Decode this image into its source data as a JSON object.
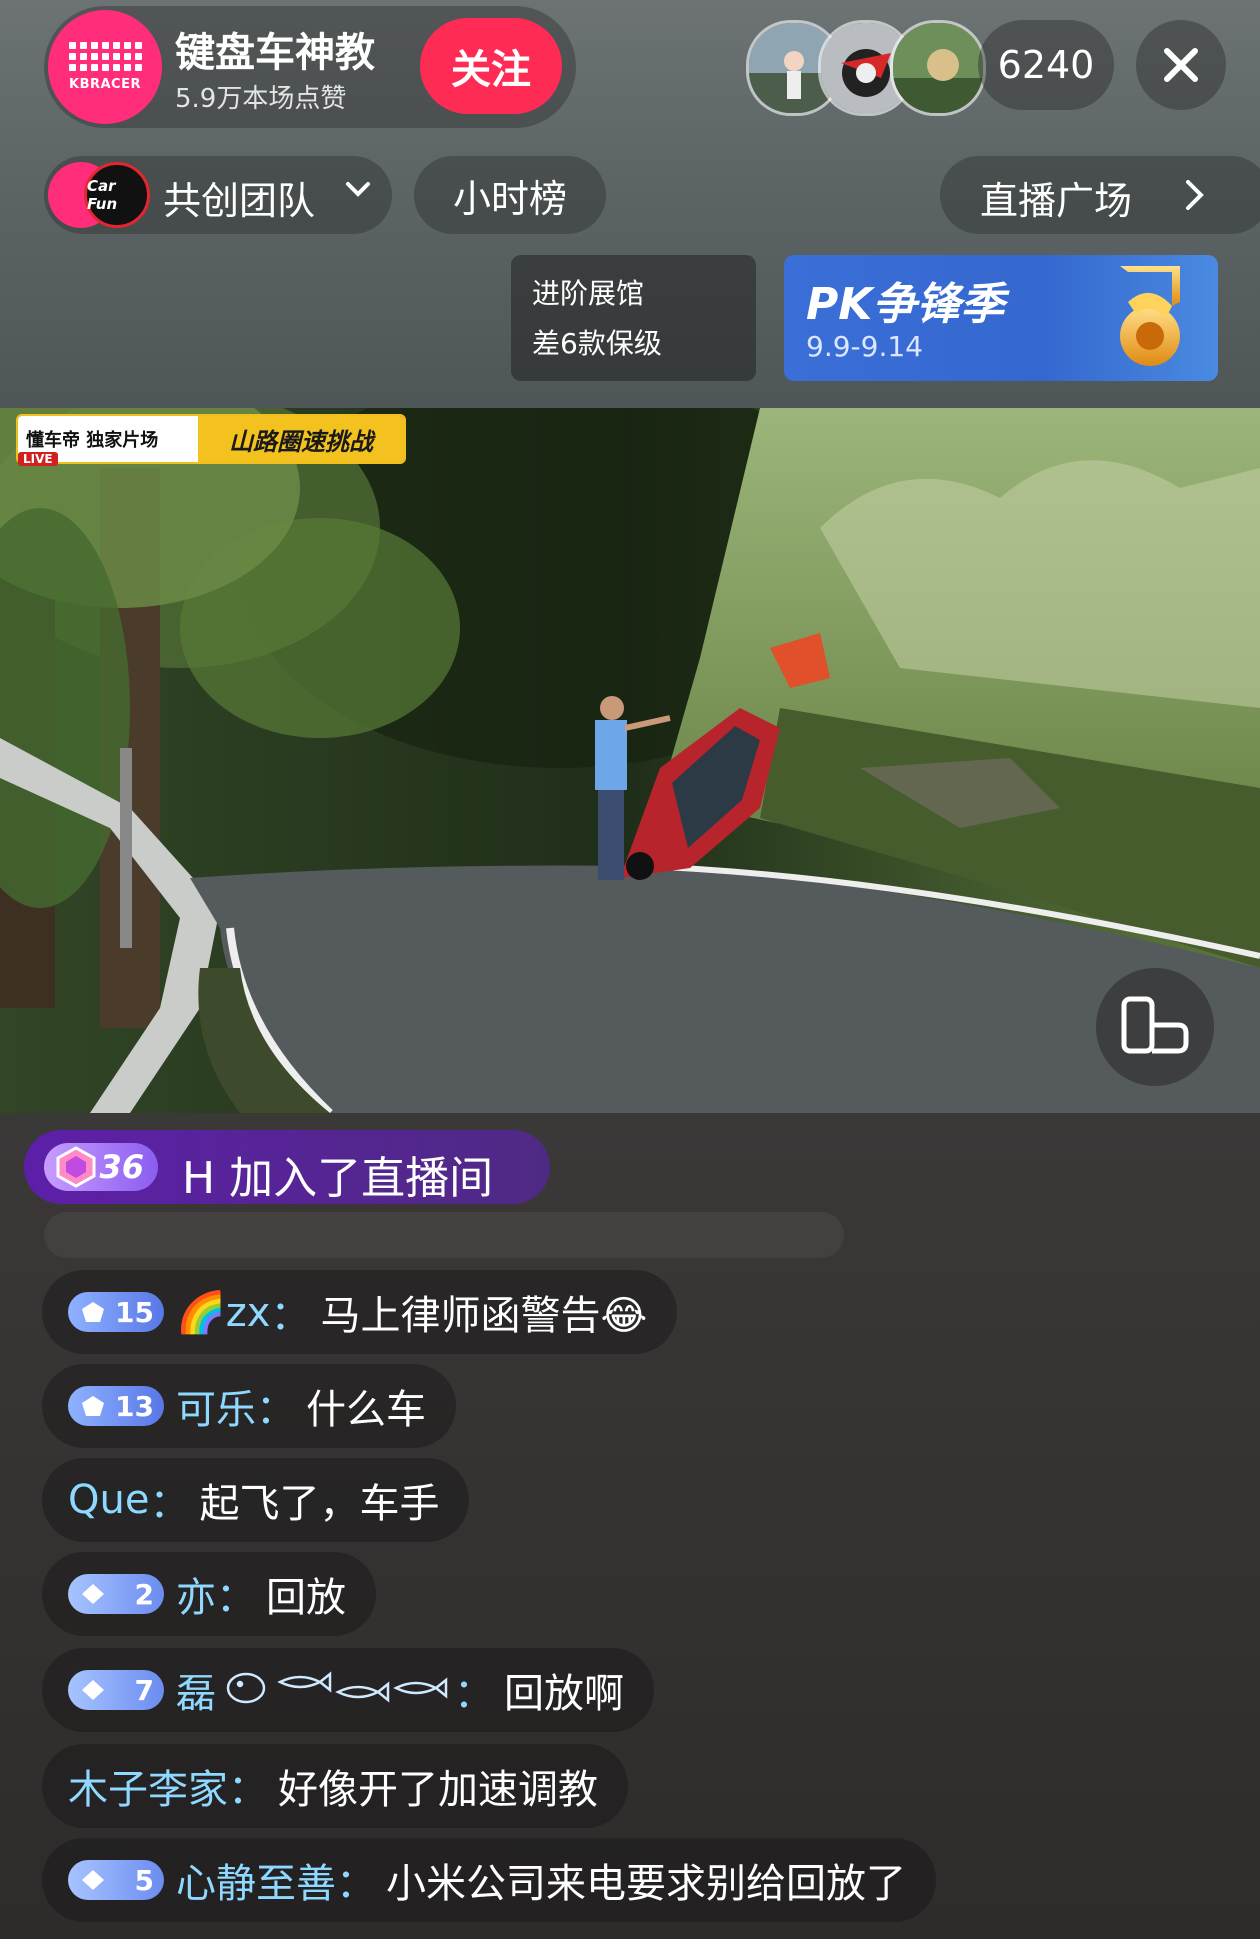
{
  "header": {
    "host_name": "键盘车神教",
    "host_likes": "5.9万本场点赞",
    "host_avatar_text": "KBRACER",
    "follow_label": "关注",
    "viewer_count": "6240"
  },
  "nav": {
    "team_label": "共创团队",
    "team_avatar_text": "Car Fun",
    "hour_rank_label": "小时榜",
    "live_square_label": "直播广场"
  },
  "promo": {
    "exhibit_line1": "进阶展馆",
    "exhibit_line2": "差6款保级",
    "pk_title": "PK争锋季",
    "pk_dates": "9.9-9.14"
  },
  "video": {
    "show_brand": "懂车帝 独家片场",
    "show_title": "山路圈速挑战",
    "live_label": "LIVE"
  },
  "chat": {
    "join": {
      "level": "36",
      "text": "H 加入了直播间"
    },
    "messages": [
      {
        "level": "15",
        "user": "🌈zx",
        "content": "马上律师函警告😂"
      },
      {
        "level": "13",
        "user": "可乐",
        "content": "什么车"
      },
      {
        "level": "",
        "user": "Que",
        "content": "起飞了，车手"
      },
      {
        "level": "2",
        "user": "亦",
        "content": "回放"
      },
      {
        "level": "7",
        "user": "磊",
        "content": "回放啊"
      },
      {
        "level": "",
        "user": "木子李家",
        "content": "好像开了加速调教"
      },
      {
        "level": "5",
        "user": "心静至善",
        "content": "小米公司来电要求别给回放了"
      }
    ]
  },
  "colors": {
    "follow": "#fe2c55",
    "brand_pink": "#ff2d7a",
    "username": "#8fd8ff",
    "pk_blue": "#3468cf",
    "join_purple": "#5d1fa8"
  },
  "icons": [
    "keyboard-logo-icon",
    "close-icon",
    "chevron-down-icon",
    "chevron-right-icon",
    "trophy-badge-icon",
    "rotate-screen-icon",
    "gem-level-icon",
    "rainbow-emoji",
    "laugh-emoji"
  ]
}
